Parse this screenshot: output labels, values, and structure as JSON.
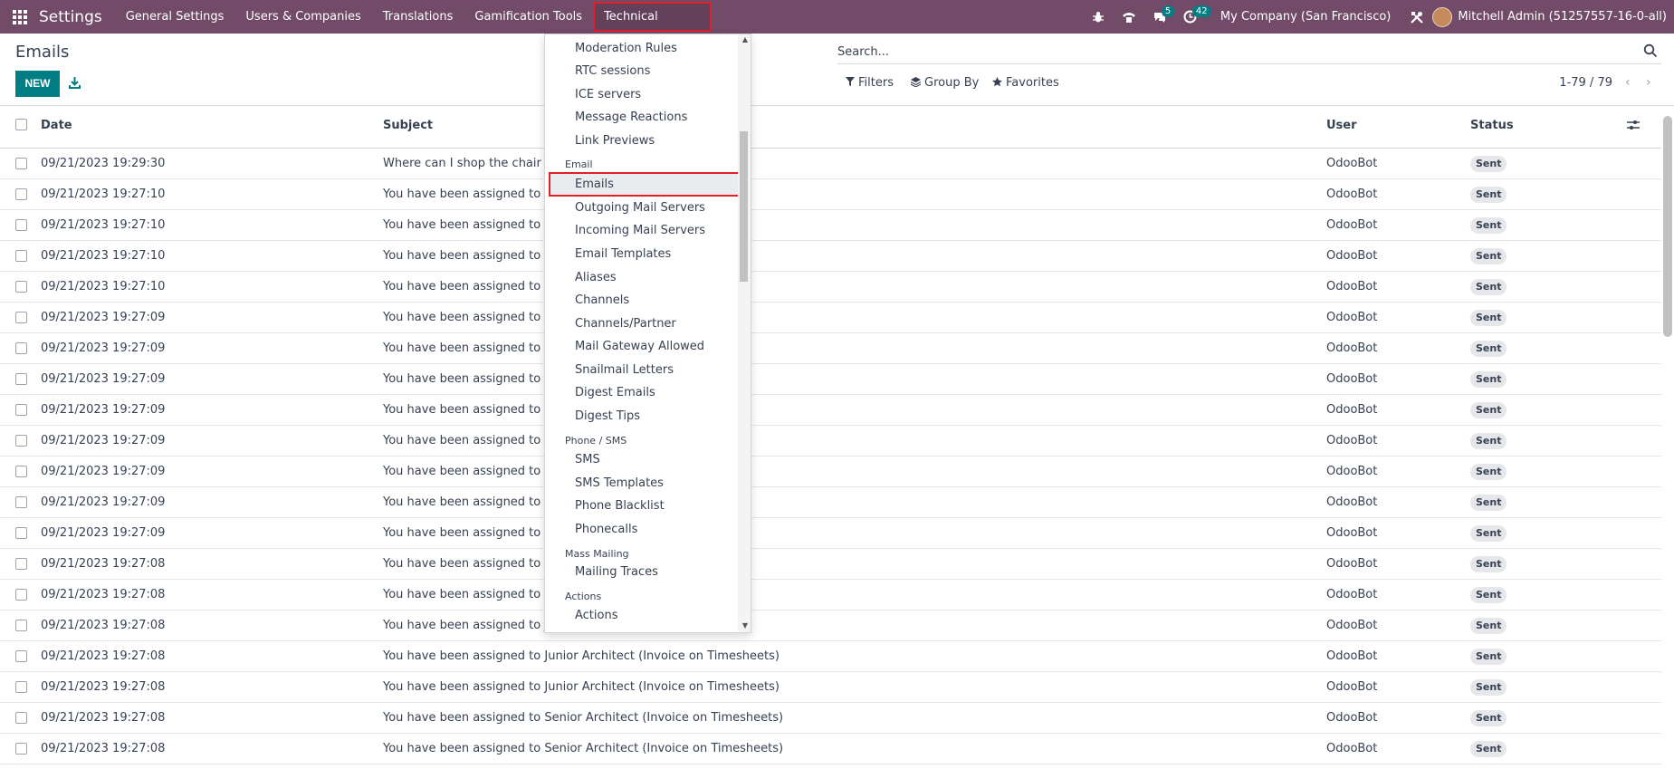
{
  "navbar": {
    "brand": "Settings",
    "menu": [
      {
        "label": "General Settings"
      },
      {
        "label": "Users & Companies"
      },
      {
        "label": "Translations"
      },
      {
        "label": "Gamification Tools"
      },
      {
        "label": "Technical"
      }
    ],
    "badges": {
      "chat": "5",
      "activity": "42"
    },
    "company": "My Company (San Francisco)",
    "user": "Mitchell Admin (51257557-16-0-all)"
  },
  "control": {
    "title": "Emails",
    "new_label": "NEW",
    "search_placeholder": "Search...",
    "filters_label": "Filters",
    "groupby_label": "Group By",
    "favorites_label": "Favorites",
    "pager": "1-79 / 79"
  },
  "table": {
    "headers": {
      "date": "Date",
      "subject": "Subject",
      "user": "User",
      "status": "Status"
    },
    "rows": [
      {
        "date": "09/21/2023 19:29:30",
        "subject": "Where can I shop the chair cov",
        "user": "OdooBot",
        "status": "Sent"
      },
      {
        "date": "09/21/2023 19:27:10",
        "subject": "You have been assigned to Plu",
        "user": "OdooBot",
        "status": "Sent"
      },
      {
        "date": "09/21/2023 19:27:10",
        "subject": "You have been assigned to Cei",
        "user": "OdooBot",
        "status": "Sent"
      },
      {
        "date": "09/21/2023 19:27:10",
        "subject": "You have been assigned to Ele",
        "user": "OdooBot",
        "status": "Sent"
      },
      {
        "date": "09/21/2023 19:27:10",
        "subject": "You have been assigned to Car",
        "user": "OdooBot",
        "status": "Sent"
      },
      {
        "date": "09/21/2023 19:27:09",
        "subject": "You have been assigned to Wa",
        "user": "OdooBot",
        "status": "Sent"
      },
      {
        "date": "09/21/2023 19:27:09",
        "subject": "You have been assigned to Pro",
        "user": "OdooBot",
        "status": "Sent"
      },
      {
        "date": "09/21/2023 19:27:09",
        "subject": "You have been assigned to Pro",
        "user": "OdooBot",
        "status": "Sent"
      },
      {
        "date": "09/21/2023 19:27:09",
        "subject": "You have been assigned to Pla",
        "user": "OdooBot",
        "status": "Sent"
      },
      {
        "date": "09/21/2023 19:27:09",
        "subject": "You have been assigned to Fur",
        "user": "OdooBot",
        "status": "Sent"
      },
      {
        "date": "09/21/2023 19:27:09",
        "subject": "You have been assigned to Fur",
        "user": "OdooBot",
        "status": "Sent"
      },
      {
        "date": "09/21/2023 19:27:09",
        "subject": "You have been assigned to Pla",
        "user": "OdooBot",
        "status": "Sent"
      },
      {
        "date": "09/21/2023 19:27:09",
        "subject": "You have been assigned to Dec",
        "user": "OdooBot",
        "status": "Sent"
      },
      {
        "date": "09/21/2023 19:27:08",
        "subject": "You have been assigned to S00",
        "user": "OdooBot",
        "status": "Sent"
      },
      {
        "date": "09/21/2023 19:27:08",
        "subject": "You have been assigned to S00",
        "user": "OdooBot",
        "status": "Sent"
      },
      {
        "date": "09/21/2023 19:27:08",
        "subject": "You have been assigned to Jun",
        "user": "OdooBot",
        "status": "Sent"
      },
      {
        "date": "09/21/2023 19:27:08",
        "subject": "You have been assigned to Junior Architect (Invoice on Timesheets)",
        "user": "OdooBot",
        "status": "Sent"
      },
      {
        "date": "09/21/2023 19:27:08",
        "subject": "You have been assigned to Junior Architect (Invoice on Timesheets)",
        "user": "OdooBot",
        "status": "Sent"
      },
      {
        "date": "09/21/2023 19:27:08",
        "subject": "You have been assigned to Senior Architect (Invoice on Timesheets)",
        "user": "OdooBot",
        "status": "Sent"
      },
      {
        "date": "09/21/2023 19:27:08",
        "subject": "You have been assigned to Senior Architect (Invoice on Timesheets)",
        "user": "OdooBot",
        "status": "Sent"
      }
    ]
  },
  "dropdown": {
    "entries": [
      {
        "kind": "item",
        "label": "Moderation Rules"
      },
      {
        "kind": "item",
        "label": "RTC sessions"
      },
      {
        "kind": "item",
        "label": "ICE servers"
      },
      {
        "kind": "item",
        "label": "Message Reactions"
      },
      {
        "kind": "item",
        "label": "Link Previews"
      },
      {
        "kind": "header",
        "label": "Email"
      },
      {
        "kind": "item",
        "label": "Emails",
        "selected": true
      },
      {
        "kind": "item",
        "label": "Outgoing Mail Servers"
      },
      {
        "kind": "item",
        "label": "Incoming Mail Servers"
      },
      {
        "kind": "item",
        "label": "Email Templates"
      },
      {
        "kind": "item",
        "label": "Aliases"
      },
      {
        "kind": "item",
        "label": "Channels"
      },
      {
        "kind": "item",
        "label": "Channels/Partner"
      },
      {
        "kind": "item",
        "label": "Mail Gateway Allowed"
      },
      {
        "kind": "item",
        "label": "Snailmail Letters"
      },
      {
        "kind": "item",
        "label": "Digest Emails"
      },
      {
        "kind": "item",
        "label": "Digest Tips"
      },
      {
        "kind": "header",
        "label": "Phone / SMS"
      },
      {
        "kind": "item",
        "label": "SMS"
      },
      {
        "kind": "item",
        "label": "SMS Templates"
      },
      {
        "kind": "item",
        "label": "Phone Blacklist"
      },
      {
        "kind": "item",
        "label": "Phonecalls"
      },
      {
        "kind": "header",
        "label": "Mass Mailing"
      },
      {
        "kind": "item",
        "label": "Mailing Traces"
      },
      {
        "kind": "header",
        "label": "Actions"
      },
      {
        "kind": "item",
        "label": "Actions"
      }
    ]
  }
}
